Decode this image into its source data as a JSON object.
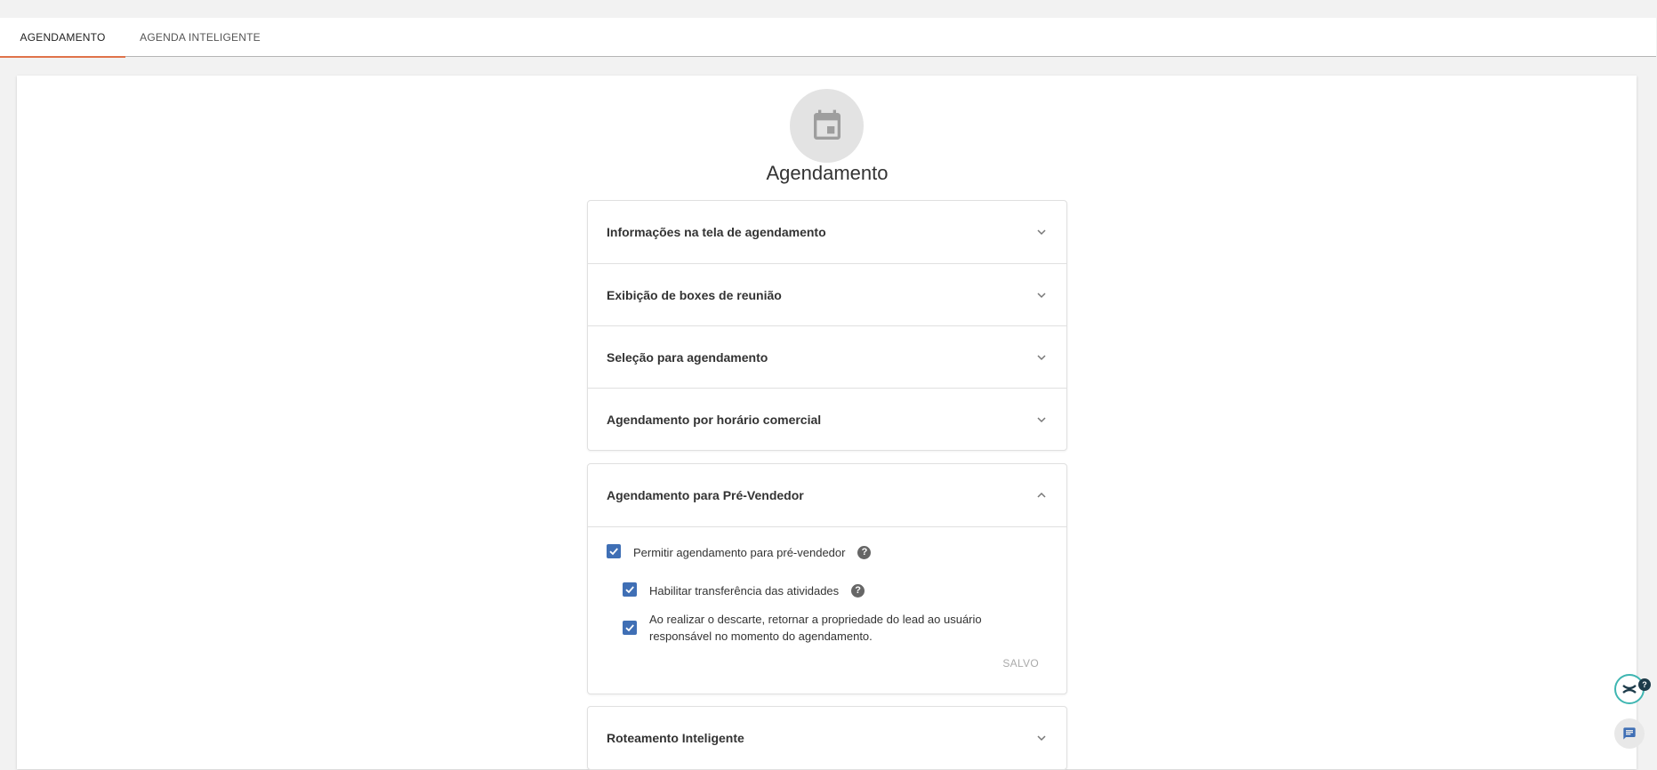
{
  "tabs": [
    {
      "label": "AGENDAMENTO",
      "active": true
    },
    {
      "label": "AGENDA INTELIGENTE",
      "active": false
    }
  ],
  "header": {
    "icon": "calendar-icon",
    "title": "Agendamento"
  },
  "sections": {
    "collapsed_top": [
      {
        "label": "Informações na tela de agendamento"
      },
      {
        "label": "Exibição de boxes de reunião"
      },
      {
        "label": "Seleção para agendamento"
      },
      {
        "label": "Agendamento por horário comercial"
      }
    ],
    "expanded": {
      "label": "Agendamento para Pré-Vendedor",
      "options": [
        {
          "label": "Permitir agendamento para pré-vendedor",
          "checked": true,
          "help": true
        },
        {
          "label": "Habilitar transferência das atividades",
          "checked": true,
          "help": true
        },
        {
          "label": "Ao realizar o descarte, retornar a propriedade do lead ao usuário responsável no momento do agendamento.",
          "checked": true,
          "help": false
        }
      ],
      "save_label": "SALVO"
    },
    "collapsed_bottom": [
      {
        "label": "Roteamento Inteligente"
      }
    ]
  },
  "floating": {
    "help_badge": "?"
  },
  "colors": {
    "accent_tab": "#e0734a",
    "checkbox": "#3f6fb5",
    "help_ring": "#3fb6b2"
  }
}
